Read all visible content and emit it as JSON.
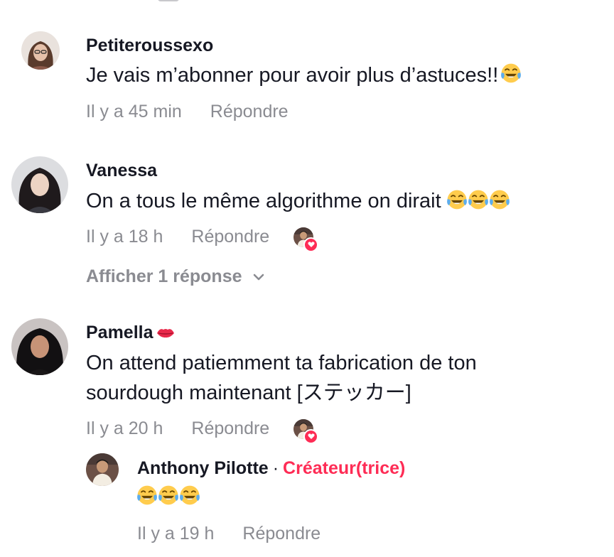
{
  "comments": [
    {
      "username": "Petiteroussexo",
      "text": "Je vais m’abonner pour avoir plus d’astuces!!",
      "emoji_icons": [
        "joy-emoji"
      ],
      "time": "Il y a 45 min",
      "reply_label": "Répondre"
    },
    {
      "username": "Vanessa",
      "text": "On a tous le même algorithme on dirait",
      "emoji_icons": [
        "joy-emoji",
        "joy-emoji",
        "joy-emoji"
      ],
      "time": "Il y a 18 h",
      "reply_label": "Répondre",
      "creator_liked": true,
      "show_replies_label": "Afficher 1 réponse"
    },
    {
      "username": "Pamella",
      "username_icon": "kiss-mark-icon",
      "text_line1": "On attend patiemment ta fabrication de ton",
      "text_line2": "sourdough maintenant [ステッカー]",
      "time": "Il y a 20 h",
      "reply_label": "Répondre",
      "creator_liked": true,
      "replies": [
        {
          "username": "Anthony Pilotte",
          "separator": "·",
          "badge": "Créateur(trice)",
          "emoji_icons": [
            "joy-emoji",
            "joy-emoji",
            "joy-emoji"
          ],
          "time": "Il y a 19 h",
          "reply_label": "Répondre"
        }
      ]
    }
  ],
  "colors": {
    "text": "#161823",
    "muted": "#8a8b91",
    "accent": "#fe2c55",
    "background": "#ffffff"
  }
}
